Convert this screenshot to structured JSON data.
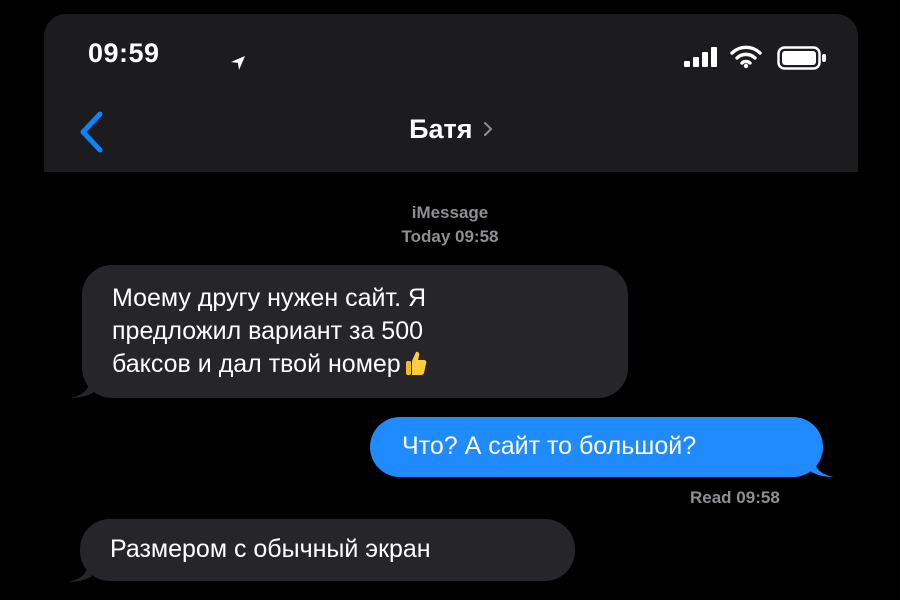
{
  "status_bar": {
    "time": "09:59",
    "icons": [
      "location-arrow-icon",
      "signal-bars-icon",
      "wifi-icon",
      "battery-icon"
    ]
  },
  "nav": {
    "back_icon": "chevron-left-icon",
    "contact_name": "Батя",
    "contact_chevron": "chevron-right-icon"
  },
  "conversation": {
    "service": "iMessage",
    "timestamp": "Today 09:58",
    "messages": [
      {
        "direction": "incoming",
        "lines": [
          "Моему другу нужен сайт. Я",
          "предложил вариант за 500",
          "баксов и дал твой номер"
        ],
        "emoji": "thumbs-up-icon"
      },
      {
        "direction": "outgoing",
        "text": "Что? А сайт то большой?"
      },
      {
        "direction": "incoming",
        "text": "Размером с обычный экран"
      }
    ],
    "read_receipt": "Read 09:58"
  },
  "colors": {
    "background": "#000000",
    "header": "#1c1c1e",
    "incoming_bubble": "#26252a",
    "outgoing_bubble": "#1f8bff",
    "accent": "#0a84ff",
    "meta_text": "#8e8e93"
  }
}
